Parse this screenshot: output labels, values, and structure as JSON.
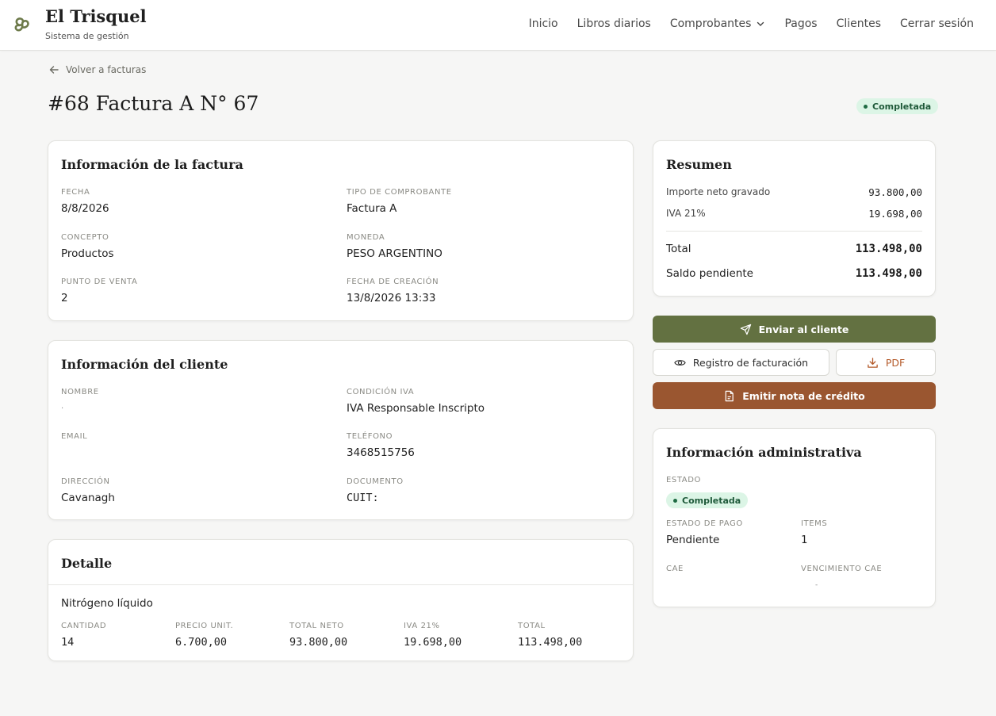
{
  "header": {
    "brand_name": "El Trisquel",
    "brand_sub": "Sistema de gestión",
    "nav": [
      {
        "label": "Inicio"
      },
      {
        "label": "Libros diarios"
      },
      {
        "label": "Comprobantes"
      },
      {
        "label": "Pagos"
      },
      {
        "label": "Clientes"
      },
      {
        "label": "Cerrar sesión"
      }
    ]
  },
  "back_label": "Volver a facturas",
  "page_title": "#68 Factura A N° 67",
  "status_badge": "Completada",
  "invoice_info": {
    "title": "Información de la factura",
    "fields": [
      {
        "label": "Fecha",
        "value": "8/8/2026"
      },
      {
        "label": "Tipo de comprobante",
        "value": "Factura A"
      },
      {
        "label": "Concepto",
        "value": "Productos"
      },
      {
        "label": "Moneda",
        "value": "PESO ARGENTINO"
      },
      {
        "label": "Punto de venta",
        "value": "2"
      },
      {
        "label": "Fecha de creación",
        "value": "13/8/2026 13:33"
      }
    ]
  },
  "client_info": {
    "title": "Información del cliente",
    "fields": [
      {
        "label": "Nombre",
        "value": "."
      },
      {
        "label": "Condición IVA",
        "value": "IVA Responsable Inscripto"
      },
      {
        "label": "Email",
        "value": ""
      },
      {
        "label": "Teléfono",
        "value": "3468515756"
      },
      {
        "label": "Dirección",
        "value": "Cavanagh"
      },
      {
        "label": "Documento",
        "value": "CUIT:"
      }
    ]
  },
  "detail": {
    "title": "Detalle",
    "item_name": "Nitrógeno líquido",
    "columns": [
      {
        "label": "Cantidad",
        "value": "14"
      },
      {
        "label": "Precio unit.",
        "value": "6.700,00"
      },
      {
        "label": "Total neto",
        "value": "93.800,00"
      },
      {
        "label": "IVA 21%",
        "value": "19.698,00"
      },
      {
        "label": "Total",
        "value": "113.498,00"
      }
    ]
  },
  "summary": {
    "title": "Resumen",
    "rows": [
      {
        "label": "Importe neto gravado",
        "value": "93.800,00"
      },
      {
        "label": "IVA 21%",
        "value": "19.698,00"
      }
    ],
    "total_label": "Total",
    "total_value": "113.498,00",
    "pending_label": "Saldo pendiente",
    "pending_value": "113.498,00"
  },
  "actions": {
    "send": "Enviar al cliente",
    "registry": "Registro de facturación",
    "pdf": "PDF",
    "credit_note": "Emitir nota de crédito"
  },
  "admin_info": {
    "title": "Información administrativa",
    "estado_label": "Estado",
    "estado_value": "Completada",
    "pago_label": "Estado de pago",
    "pago_value": "Pendiente",
    "items_label": "Items",
    "items_value": "1",
    "cae_label": "CAE",
    "cae_value": "",
    "venc_label": "Vencimiento CAE",
    "venc_value": "-"
  },
  "colors": {
    "primary": "#637141",
    "credit": "#9a5630",
    "badge_bg": "#dcf5e6",
    "badge_text": "#1f5a3a"
  }
}
